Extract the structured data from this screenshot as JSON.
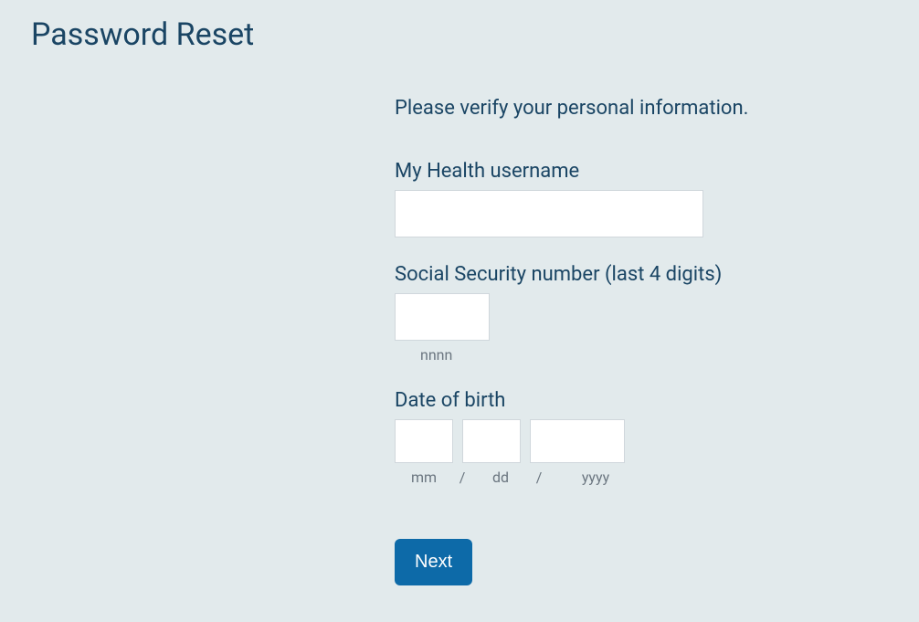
{
  "page": {
    "title": "Password Reset"
  },
  "form": {
    "instruction": "Please verify your personal information.",
    "username": {
      "label": "My Health username",
      "value": ""
    },
    "ssn": {
      "label": "Social Security number (last 4 digits)",
      "value": "",
      "hint": "nnnn"
    },
    "dob": {
      "label": "Date of birth",
      "mm": {
        "value": "",
        "hint": "mm"
      },
      "dd": {
        "value": "",
        "hint": "dd"
      },
      "yyyy": {
        "value": "",
        "hint": "yyyy"
      },
      "separator": "/"
    },
    "next_label": "Next"
  }
}
